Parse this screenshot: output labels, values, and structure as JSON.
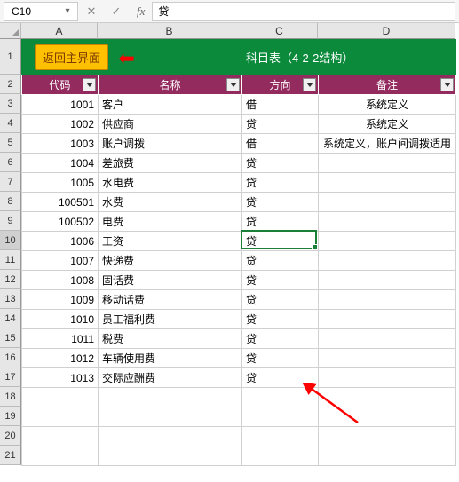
{
  "namebox": {
    "ref": "C10"
  },
  "formula_bar": {
    "fx": "fx",
    "value": "贷"
  },
  "col_widths": {
    "A": 86,
    "B": 162,
    "C": 86,
    "D": 155
  },
  "columns": [
    "A",
    "B",
    "C",
    "D"
  ],
  "title": {
    "button": "返回主界面",
    "text": "科目表（4-2-2结构）"
  },
  "headers": {
    "code": "代码",
    "name": "名称",
    "direction": "方向",
    "remark": "备注"
  },
  "rows": [
    {
      "code": "1001",
      "name": "客户",
      "dir": "借",
      "remark": "系统定义"
    },
    {
      "code": "1002",
      "name": "供应商",
      "dir": "贷",
      "remark": "系统定义"
    },
    {
      "code": "1003",
      "name": "账户调拨",
      "dir": "借",
      "remark": "系统定义，账户间调拨适用"
    },
    {
      "code": "1004",
      "name": "差旅费",
      "dir": "贷",
      "remark": ""
    },
    {
      "code": "1005",
      "name": "水电费",
      "dir": "贷",
      "remark": ""
    },
    {
      "code": "100501",
      "name": "水费",
      "dir": "贷",
      "remark": ""
    },
    {
      "code": "100502",
      "name": "电费",
      "dir": "贷",
      "remark": ""
    },
    {
      "code": "1006",
      "name": "工资",
      "dir": "贷",
      "remark": ""
    },
    {
      "code": "1007",
      "name": "快递费",
      "dir": "贷",
      "remark": ""
    },
    {
      "code": "1008",
      "name": "固话费",
      "dir": "贷",
      "remark": ""
    },
    {
      "code": "1009",
      "name": "移动话费",
      "dir": "贷",
      "remark": ""
    },
    {
      "code": "1010",
      "name": "员工福利费",
      "dir": "贷",
      "remark": ""
    },
    {
      "code": "1011",
      "name": "税费",
      "dir": "贷",
      "remark": ""
    },
    {
      "code": "1012",
      "name": "车辆使用费",
      "dir": "贷",
      "remark": ""
    },
    {
      "code": "1013",
      "name": "交际应酬费",
      "dir": "贷",
      "remark": ""
    }
  ],
  "row_heights": {
    "r1": 40,
    "default": 22
  },
  "active_cell": "C10",
  "chart_data": {
    "type": "table",
    "title": "科目表（4-2-2结构）",
    "columns": [
      "代码",
      "名称",
      "方向",
      "备注"
    ],
    "records": [
      [
        "1001",
        "客户",
        "借",
        "系统定义"
      ],
      [
        "1002",
        "供应商",
        "贷",
        "系统定义"
      ],
      [
        "1003",
        "账户调拨",
        "借",
        "系统定义，账户间调拨适用"
      ],
      [
        "1004",
        "差旅费",
        "贷",
        ""
      ],
      [
        "1005",
        "水电费",
        "贷",
        ""
      ],
      [
        "100501",
        "水费",
        "贷",
        ""
      ],
      [
        "100502",
        "电费",
        "贷",
        ""
      ],
      [
        "1006",
        "工资",
        "贷",
        ""
      ],
      [
        "1007",
        "快递费",
        "贷",
        ""
      ],
      [
        "1008",
        "固话费",
        "贷",
        ""
      ],
      [
        "1009",
        "移动话费",
        "贷",
        ""
      ],
      [
        "1010",
        "员工福利费",
        "贷",
        ""
      ],
      [
        "1011",
        "税费",
        "贷",
        ""
      ],
      [
        "1012",
        "车辆使用费",
        "贷",
        ""
      ],
      [
        "1013",
        "交际应酬费",
        "贷",
        ""
      ]
    ]
  }
}
